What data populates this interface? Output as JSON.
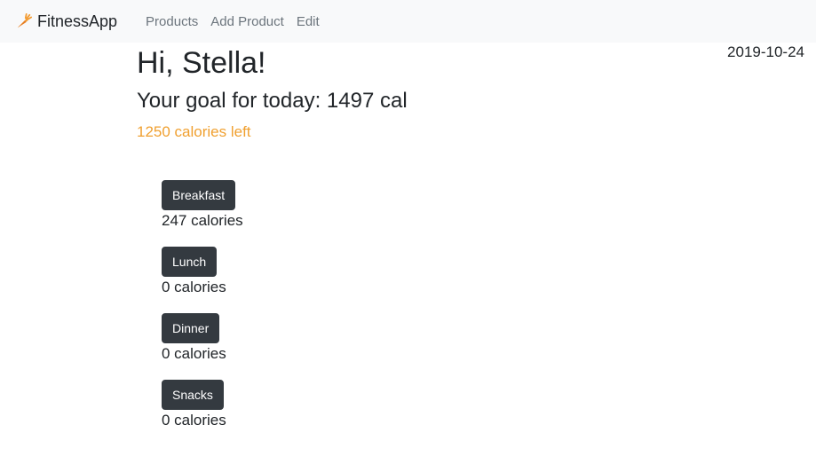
{
  "navbar": {
    "brand": "FitnessApp",
    "brand_icon": "carrot-icon",
    "links": [
      {
        "label": "Products"
      },
      {
        "label": "Add Product"
      },
      {
        "label": "Edit"
      }
    ]
  },
  "date": "2019-10-24",
  "greeting": "Hi, Stella!",
  "goal": "Your goal for today: 1497 cal",
  "calories_left": "1250 calories left",
  "colors": {
    "navbar_bg": "#f8f9fa",
    "button_bg": "#343a40",
    "calories_left": "#f0a030"
  },
  "meals": [
    {
      "label": "Breakfast",
      "calories": "247 calories"
    },
    {
      "label": "Lunch",
      "calories": "0 calories"
    },
    {
      "label": "Dinner",
      "calories": "0 calories"
    },
    {
      "label": "Snacks",
      "calories": "0 calories"
    }
  ]
}
